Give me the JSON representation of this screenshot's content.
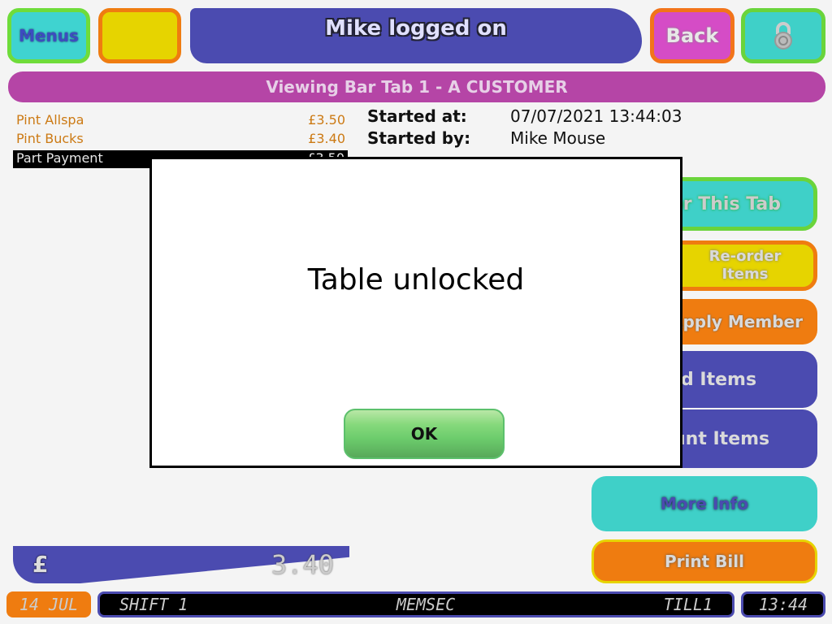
{
  "header": {
    "menus_label": "Menus",
    "title": "Mike logged on",
    "back_label": "Back",
    "lock_icon": "padlock-icon"
  },
  "tab_title": "Viewing Bar Tab 1 - A CUSTOMER",
  "items": [
    {
      "name": "Pint Allspa",
      "price": "£3.50"
    },
    {
      "name": "Pint Bucks",
      "price": "£3.40"
    },
    {
      "name": "Part Payment",
      "price": "£3.50",
      "selected": true
    }
  ],
  "info": {
    "started_at_label": "Started at:",
    "started_at_value": "07/07/2021 13:44:03",
    "started_by_label": "Started by:",
    "started_by_value": "Mike Mouse"
  },
  "actions": {
    "this_tab": "or This Tab",
    "reorder": "Re-order Items",
    "apply_member": "Apply Member",
    "void_items": "d Items",
    "discount_items": "unt Items",
    "more_info": "More Info",
    "print_bill": "Print Bill"
  },
  "total": {
    "currency": "£",
    "value": "3.40"
  },
  "status": {
    "date": "14 JUL",
    "shift": "SHIFT 1",
    "memsec": "MEMSEC",
    "till": "TILL1",
    "time": "13:44"
  },
  "dialog": {
    "message": "Table unlocked",
    "ok_label": "OK"
  }
}
